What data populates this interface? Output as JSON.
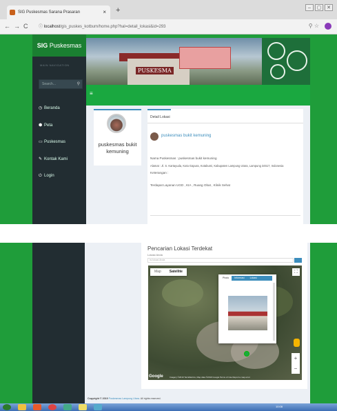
{
  "browser": {
    "tab_title": "SIG Puskesmas Sarana Prasaran",
    "tab_close": "×",
    "new_tab": "+",
    "window_controls": [
      "–",
      "▢",
      "✕"
    ],
    "nav_back": "←",
    "nav_forward": "→",
    "nav_reload": "C",
    "url_host": "localhost",
    "url_path": "/gis_puskes_kotbum/home.php?hal=detail_lokasi&id=293",
    "zoom_icon": "magnifier-icon",
    "bookmark_icon": "star-icon"
  },
  "sidebar": {
    "brand_bold": "SIG",
    "brand_rest": " Puskesmas",
    "header": "MAIN NAVIGATION",
    "search_placeholder": "Search...",
    "items": [
      {
        "icon": "◷",
        "label": "Beranda"
      },
      {
        "icon": "⬢",
        "label": "Peta"
      },
      {
        "icon": "▭",
        "label": "Puskesmas"
      },
      {
        "icon": "✎",
        "label": "Kontak Kami"
      },
      {
        "icon": "⏻",
        "label": "Login"
      }
    ]
  },
  "banner": {
    "building_text": "PUSKESMA"
  },
  "toggle": "≡",
  "profile_card": {
    "name": "puskesmas bukit kemuning"
  },
  "detail": {
    "tab": "Detail Lokasi",
    "title": "puskesmas bukit kemuning",
    "lines": [
      "Nama Puskesmas : puskesmas bukit kemuning",
      "Alamat : Jl. S. Kartayuda, Kota Gapura, Kotabumi, Kabupaten Lampung Utara, Lampung 34517, Indonesia",
      "Keterangan :",
      "",
      "Terdapat Layanan UGD , KIA , Ruang Obat , Klinik Sehat"
    ]
  },
  "map_section": {
    "title": "Pencarian Lokasi Terdekat",
    "field_label": "Lokasi Anda",
    "field_placeholder": "Isi lokasi Anda",
    "map_types": [
      "Map",
      "Satellite"
    ],
    "selected_map_type": "Satellite",
    "popup_tabs": [
      "Photo",
      "Informasi",
      "Lokasi"
    ],
    "selected_popup_tab": "Photo",
    "zoom_in": "+",
    "zoom_out": "−",
    "fullscreen": "⛶",
    "google_label": "Google",
    "terms": "Imagery ©2019 TerraMetrics, Map data ©2019 Google   Terms of Use   Report a map error"
  },
  "footer": {
    "copyright_bold": "Copyright © 2019",
    "copyright_link": " Puskesmas Lampung Utara.",
    "copyright_rest": " All rights reserved."
  },
  "taskbar": {
    "clock": "10:08"
  },
  "colors": {
    "page_green": "#1f9d3a",
    "sidebar_dark": "#222d32",
    "accent_blue": "#3c8dbc",
    "header_green": "#1aa840"
  }
}
